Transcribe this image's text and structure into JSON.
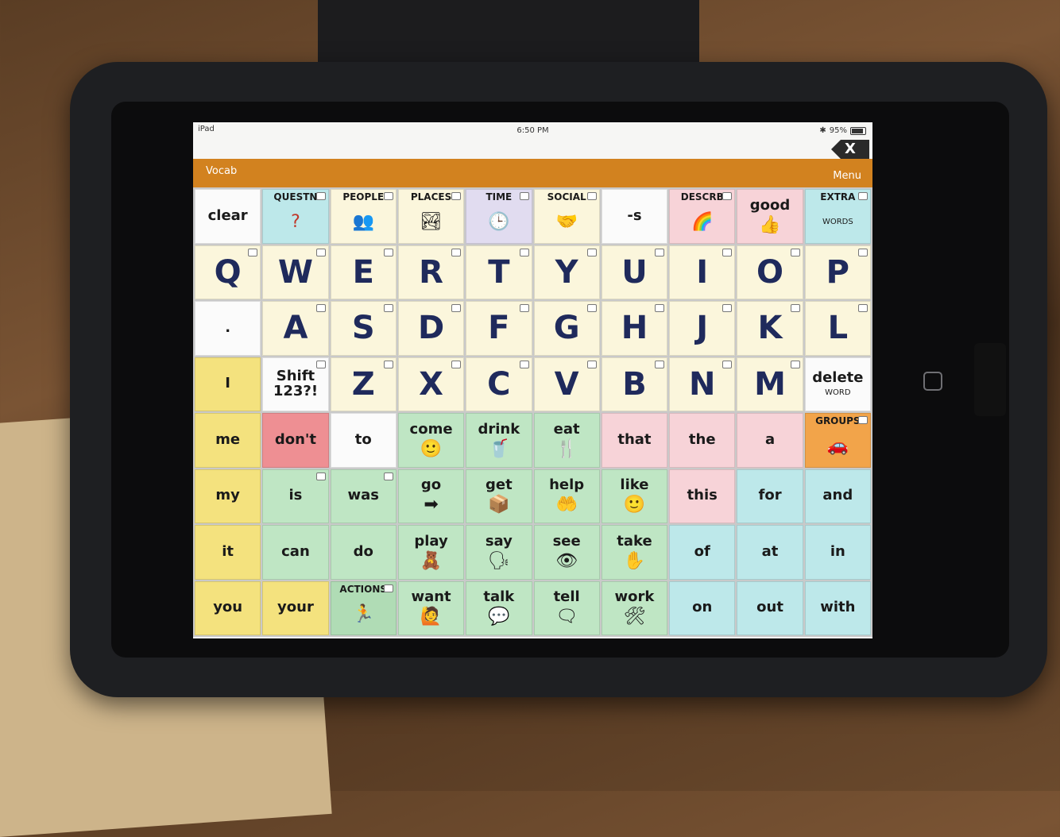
{
  "status_bar": {
    "device": "iPad",
    "time": "6:50 PM",
    "battery": "95%"
  },
  "close_label": "X",
  "title_bar": {
    "left": "Vocab",
    "right": "Menu"
  },
  "grid": [
    {
      "label": "clear",
      "color": "white",
      "kind": "word",
      "pic": ""
    },
    {
      "label": "QUESTN",
      "color": "aqua",
      "kind": "cat",
      "pic": "?"
    },
    {
      "label": "PEOPLE",
      "color": "cream",
      "kind": "cat",
      "pic": "👥"
    },
    {
      "label": "PLACES",
      "color": "cream",
      "kind": "cat",
      "pic": "🏞"
    },
    {
      "label": "TIME",
      "color": "lavender",
      "kind": "cat",
      "pic": "🕒"
    },
    {
      "label": "SOCIAL",
      "color": "cream",
      "kind": "cat",
      "pic": "🤝"
    },
    {
      "label": "-s",
      "color": "white",
      "kind": "word",
      "pic": ""
    },
    {
      "label": "DESCRB",
      "color": "pink",
      "kind": "cat",
      "pic": "🌈"
    },
    {
      "label": "good",
      "color": "pink",
      "kind": "word",
      "pic": "👍"
    },
    {
      "label": "EXTRA",
      "color": "aqua",
      "kind": "cat",
      "pic": "WORDS"
    },
    {
      "label": "Q",
      "color": "cream",
      "kind": "letter"
    },
    {
      "label": "W",
      "color": "cream",
      "kind": "letter"
    },
    {
      "label": "E",
      "color": "cream",
      "kind": "letter"
    },
    {
      "label": "R",
      "color": "cream",
      "kind": "letter"
    },
    {
      "label": "T",
      "color": "cream",
      "kind": "letter"
    },
    {
      "label": "Y",
      "color": "cream",
      "kind": "letter"
    },
    {
      "label": "U",
      "color": "cream",
      "kind": "letter"
    },
    {
      "label": "I",
      "color": "cream",
      "kind": "letter"
    },
    {
      "label": "O",
      "color": "cream",
      "kind": "letter"
    },
    {
      "label": "P",
      "color": "cream",
      "kind": "letter"
    },
    {
      "label": ".",
      "color": "white",
      "kind": "word",
      "pic": ""
    },
    {
      "label": "A",
      "color": "cream",
      "kind": "letter"
    },
    {
      "label": "S",
      "color": "cream",
      "kind": "letter"
    },
    {
      "label": "D",
      "color": "cream",
      "kind": "letter"
    },
    {
      "label": "F",
      "color": "cream",
      "kind": "letter"
    },
    {
      "label": "G",
      "color": "cream",
      "kind": "letter"
    },
    {
      "label": "H",
      "color": "cream",
      "kind": "letter"
    },
    {
      "label": "J",
      "color": "cream",
      "kind": "letter"
    },
    {
      "label": "K",
      "color": "cream",
      "kind": "letter"
    },
    {
      "label": "L",
      "color": "cream",
      "kind": "letter"
    },
    {
      "label": "I",
      "color": "yellow",
      "kind": "word",
      "pic": ""
    },
    {
      "label": "Shift 123?!",
      "color": "white",
      "kind": "word",
      "pic": ""
    },
    {
      "label": "Z",
      "color": "cream",
      "kind": "letter"
    },
    {
      "label": "X",
      "color": "cream",
      "kind": "letter"
    },
    {
      "label": "C",
      "color": "cream",
      "kind": "letter"
    },
    {
      "label": "V",
      "color": "cream",
      "kind": "letter"
    },
    {
      "label": "B",
      "color": "cream",
      "kind": "letter"
    },
    {
      "label": "N",
      "color": "cream",
      "kind": "letter"
    },
    {
      "label": "M",
      "color": "cream",
      "kind": "letter"
    },
    {
      "label": "delete",
      "color": "white",
      "kind": "word",
      "pic": "WORD"
    },
    {
      "label": "me",
      "color": "yellow",
      "kind": "word",
      "pic": ""
    },
    {
      "label": "don't",
      "color": "red",
      "kind": "word",
      "pic": ""
    },
    {
      "label": "to",
      "color": "white",
      "kind": "word",
      "pic": ""
    },
    {
      "label": "come",
      "color": "green",
      "kind": "word",
      "pic": "🙂"
    },
    {
      "label": "drink",
      "color": "green",
      "kind": "word",
      "pic": "🥤"
    },
    {
      "label": "eat",
      "color": "green",
      "kind": "word",
      "pic": "🍴"
    },
    {
      "label": "that",
      "color": "pink",
      "kind": "word",
      "pic": ""
    },
    {
      "label": "the",
      "color": "pink",
      "kind": "word",
      "pic": ""
    },
    {
      "label": "a",
      "color": "pink",
      "kind": "word",
      "pic": ""
    },
    {
      "label": "GROUPS",
      "color": "orange",
      "kind": "cat",
      "pic": "🚗"
    },
    {
      "label": "my",
      "color": "yellow",
      "kind": "word",
      "pic": ""
    },
    {
      "label": "is",
      "color": "green",
      "kind": "word",
      "pic": ""
    },
    {
      "label": "was",
      "color": "green",
      "kind": "word",
      "pic": ""
    },
    {
      "label": "go",
      "color": "green",
      "kind": "word",
      "pic": "➡"
    },
    {
      "label": "get",
      "color": "green",
      "kind": "word",
      "pic": "📦"
    },
    {
      "label": "help",
      "color": "green",
      "kind": "word",
      "pic": "🤲"
    },
    {
      "label": "like",
      "color": "green",
      "kind": "word",
      "pic": "🙂"
    },
    {
      "label": "this",
      "color": "pink",
      "kind": "word",
      "pic": ""
    },
    {
      "label": "for",
      "color": "aqua",
      "kind": "word",
      "pic": ""
    },
    {
      "label": "and",
      "color": "aqua",
      "kind": "word",
      "pic": ""
    },
    {
      "label": "it",
      "color": "yellow",
      "kind": "word",
      "pic": ""
    },
    {
      "label": "can",
      "color": "green",
      "kind": "word",
      "pic": ""
    },
    {
      "label": "do",
      "color": "green",
      "kind": "word",
      "pic": ""
    },
    {
      "label": "play",
      "color": "green",
      "kind": "word",
      "pic": "🧸"
    },
    {
      "label": "say",
      "color": "green",
      "kind": "word",
      "pic": "🗣"
    },
    {
      "label": "see",
      "color": "green",
      "kind": "word",
      "pic": "👁"
    },
    {
      "label": "take",
      "color": "green",
      "kind": "word",
      "pic": "✋"
    },
    {
      "label": "of",
      "color": "aqua",
      "kind": "word",
      "pic": ""
    },
    {
      "label": "at",
      "color": "aqua",
      "kind": "word",
      "pic": ""
    },
    {
      "label": "in",
      "color": "aqua",
      "kind": "word",
      "pic": ""
    },
    {
      "label": "you",
      "color": "yellow",
      "kind": "word",
      "pic": ""
    },
    {
      "label": "your",
      "color": "yellow",
      "kind": "word",
      "pic": ""
    },
    {
      "label": "ACTIONS",
      "color": "green2",
      "kind": "cat",
      "pic": "🏃"
    },
    {
      "label": "want",
      "color": "green",
      "kind": "word",
      "pic": "🙋"
    },
    {
      "label": "talk",
      "color": "green",
      "kind": "word",
      "pic": "💬"
    },
    {
      "label": "tell",
      "color": "green",
      "kind": "word",
      "pic": "🗨"
    },
    {
      "label": "work",
      "color": "green",
      "kind": "word",
      "pic": "🛠"
    },
    {
      "label": "on",
      "color": "aqua",
      "kind": "word",
      "pic": ""
    },
    {
      "label": "out",
      "color": "aqua",
      "kind": "word",
      "pic": ""
    },
    {
      "label": "with",
      "color": "aqua",
      "kind": "word",
      "pic": ""
    }
  ]
}
